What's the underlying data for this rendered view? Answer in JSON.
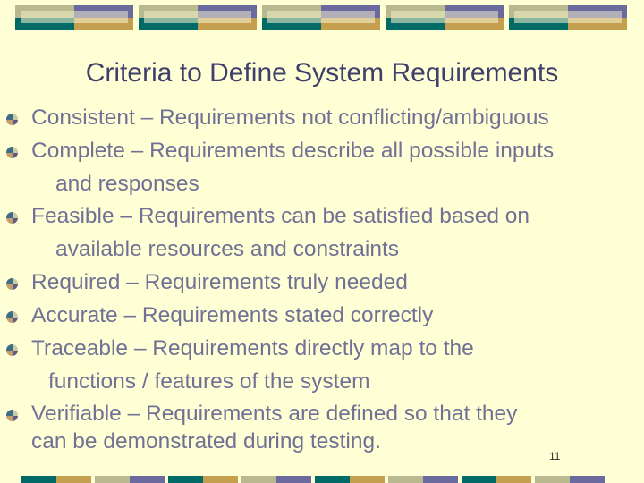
{
  "slide": {
    "title": "Criteria to Define System Requirements",
    "page_number": "11",
    "colors": {
      "background": "#ffffd6",
      "title_text": "#3e3f6b",
      "body_text": "#717196",
      "teal": "#006a66",
      "gold": "#c49f4e",
      "khaki": "#b8b98e",
      "purple": "#6a6a9e"
    },
    "bullet_icon": "quartered-circle-bullet-icon",
    "bullets": [
      {
        "lines": [
          "Consistent – Requirements not conflicting/ambiguous"
        ]
      },
      {
        "lines": [
          "Complete – Requirements describe all possible inputs",
          "and responses"
        ]
      },
      {
        "lines": [
          "Feasible – Requirements can be satisfied based on",
          "available resources and constraints"
        ]
      },
      {
        "lines": [
          "Required – Requirements truly needed"
        ]
      },
      {
        "lines": [
          "Accurate – Requirements stated correctly"
        ]
      },
      {
        "lines": [
          "Traceable – Requirements directly map to the",
          "functions / features of the system"
        ]
      },
      {
        "lines": [
          "Verifiable – Requirements are defined so that they",
          "can be demonstrated during testing."
        ]
      }
    ]
  }
}
